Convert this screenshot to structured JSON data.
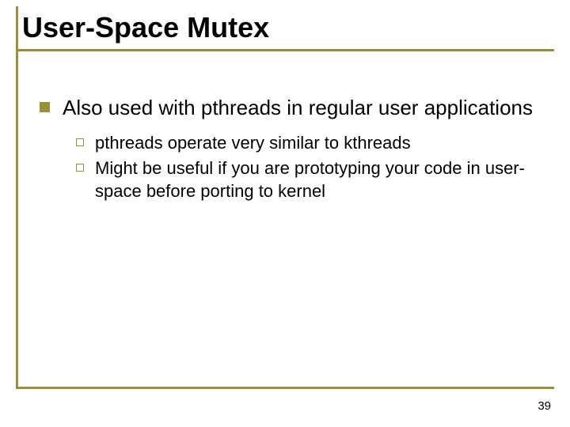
{
  "title": "User-Space Mutex",
  "points": {
    "main": "Also used with pthreads in regular user applications",
    "subs": [
      "pthreads operate very similar to kthreads",
      "Might be useful if you are prototyping your code in user-space before porting to kernel"
    ]
  },
  "page_number": "39"
}
